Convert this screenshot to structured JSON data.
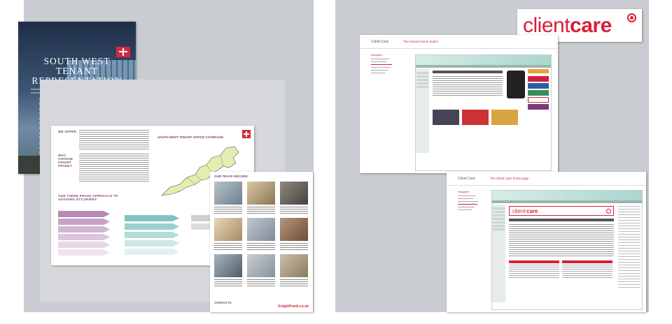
{
  "brochure": {
    "cover": {
      "title_lines": [
        "SOUTH WEST",
        "TENANT",
        "REPRESENTATION"
      ],
      "subtitle": "Delivering property solutions tailored to your strategic advice and business success"
    },
    "spread": {
      "we_offer": "WE OFFER",
      "why_choose": "WHY CHOOSE KNIGHT FRANK?",
      "approach": "OUR THREE PHASE APPROACH TO ADVISING OCCUPIERS",
      "map_title": "SOUTH WEST TENANT OFFICE COVERAGE"
    },
    "track": {
      "title": "OUR TRACK RECORD",
      "contacts": "CONTACTS",
      "site": "KnightFrank.co.uk"
    }
  },
  "client_care_logo": {
    "light": "client",
    "bold": "care"
  },
  "screens": [
    {
      "header_left": "Client Care",
      "header_right": "The intranet home button",
      "nav_title": "Navigation"
    },
    {
      "header_left": "Client Care",
      "header_right": "The Client Care home page",
      "nav_title": "Navigation",
      "page_logo_light": "client",
      "page_logo_bold": "care"
    }
  ],
  "colors": {
    "panel": "#c9ccd0",
    "brand_red": "#d6203a",
    "brochure_purple": "#7b3f7a",
    "map_green": "#e4ecb0",
    "intranet_teal": "#a9d6cd"
  }
}
